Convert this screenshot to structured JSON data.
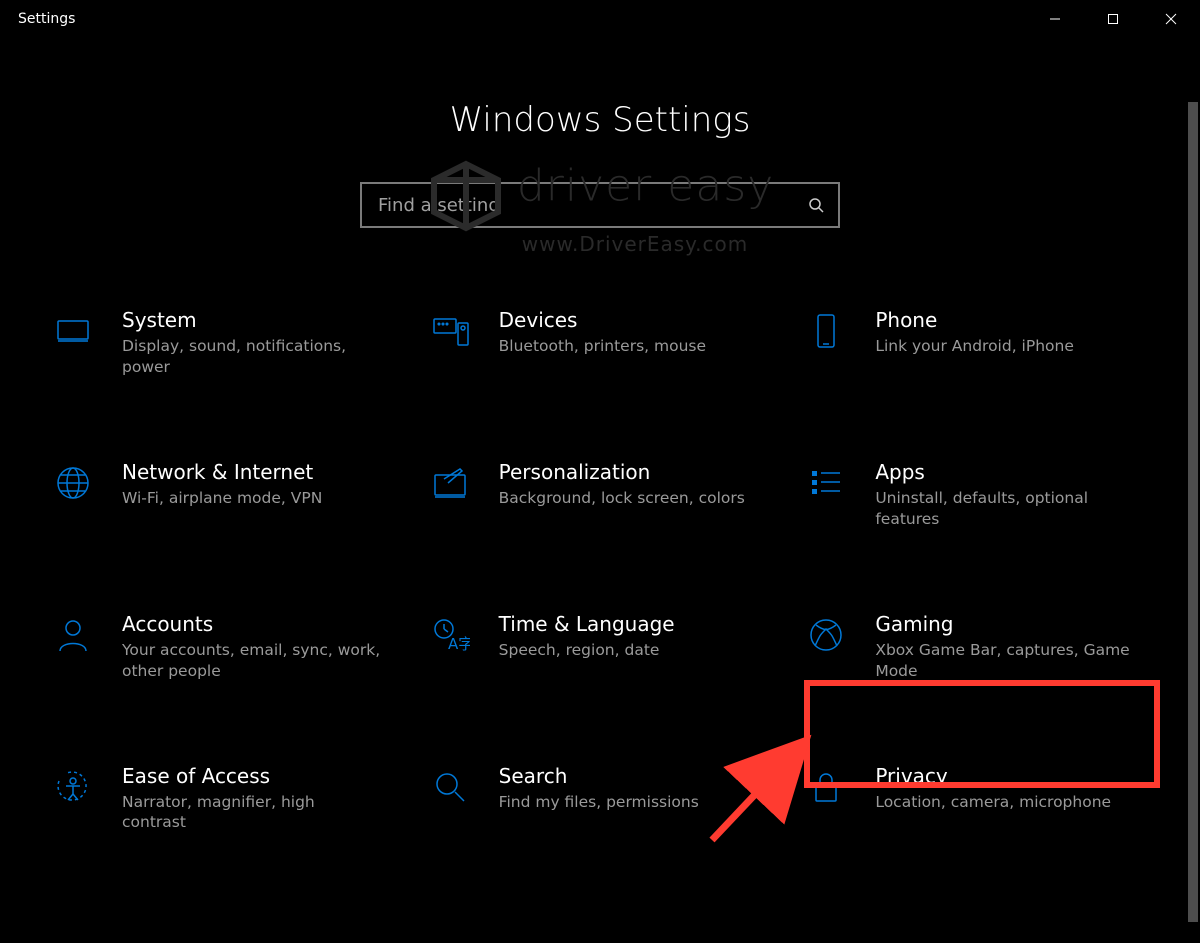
{
  "window": {
    "title": "Settings"
  },
  "page": {
    "heading": "Windows Settings",
    "search_placeholder": "Find a setting"
  },
  "watermark": {
    "line1": "driver easy",
    "line2": "www.DriverEasy.com"
  },
  "categories": [
    {
      "id": "system",
      "title": "System",
      "desc": "Display, sound, notifications, power"
    },
    {
      "id": "devices",
      "title": "Devices",
      "desc": "Bluetooth, printers, mouse"
    },
    {
      "id": "phone",
      "title": "Phone",
      "desc": "Link your Android, iPhone"
    },
    {
      "id": "network",
      "title": "Network & Internet",
      "desc": "Wi-Fi, airplane mode, VPN"
    },
    {
      "id": "personalization",
      "title": "Personalization",
      "desc": "Background, lock screen, colors"
    },
    {
      "id": "apps",
      "title": "Apps",
      "desc": "Uninstall, defaults, optional features"
    },
    {
      "id": "accounts",
      "title": "Accounts",
      "desc": "Your accounts, email, sync, work, other people"
    },
    {
      "id": "time",
      "title": "Time & Language",
      "desc": "Speech, region, date"
    },
    {
      "id": "gaming",
      "title": "Gaming",
      "desc": "Xbox Game Bar, captures, Game Mode"
    },
    {
      "id": "ease",
      "title": "Ease of Access",
      "desc": "Narrator, magnifier, high contrast"
    },
    {
      "id": "search",
      "title": "Search",
      "desc": "Find my files, permissions"
    },
    {
      "id": "privacy",
      "title": "Privacy",
      "desc": "Location, camera, microphone"
    }
  ],
  "annotation": {
    "target": "gaming"
  }
}
